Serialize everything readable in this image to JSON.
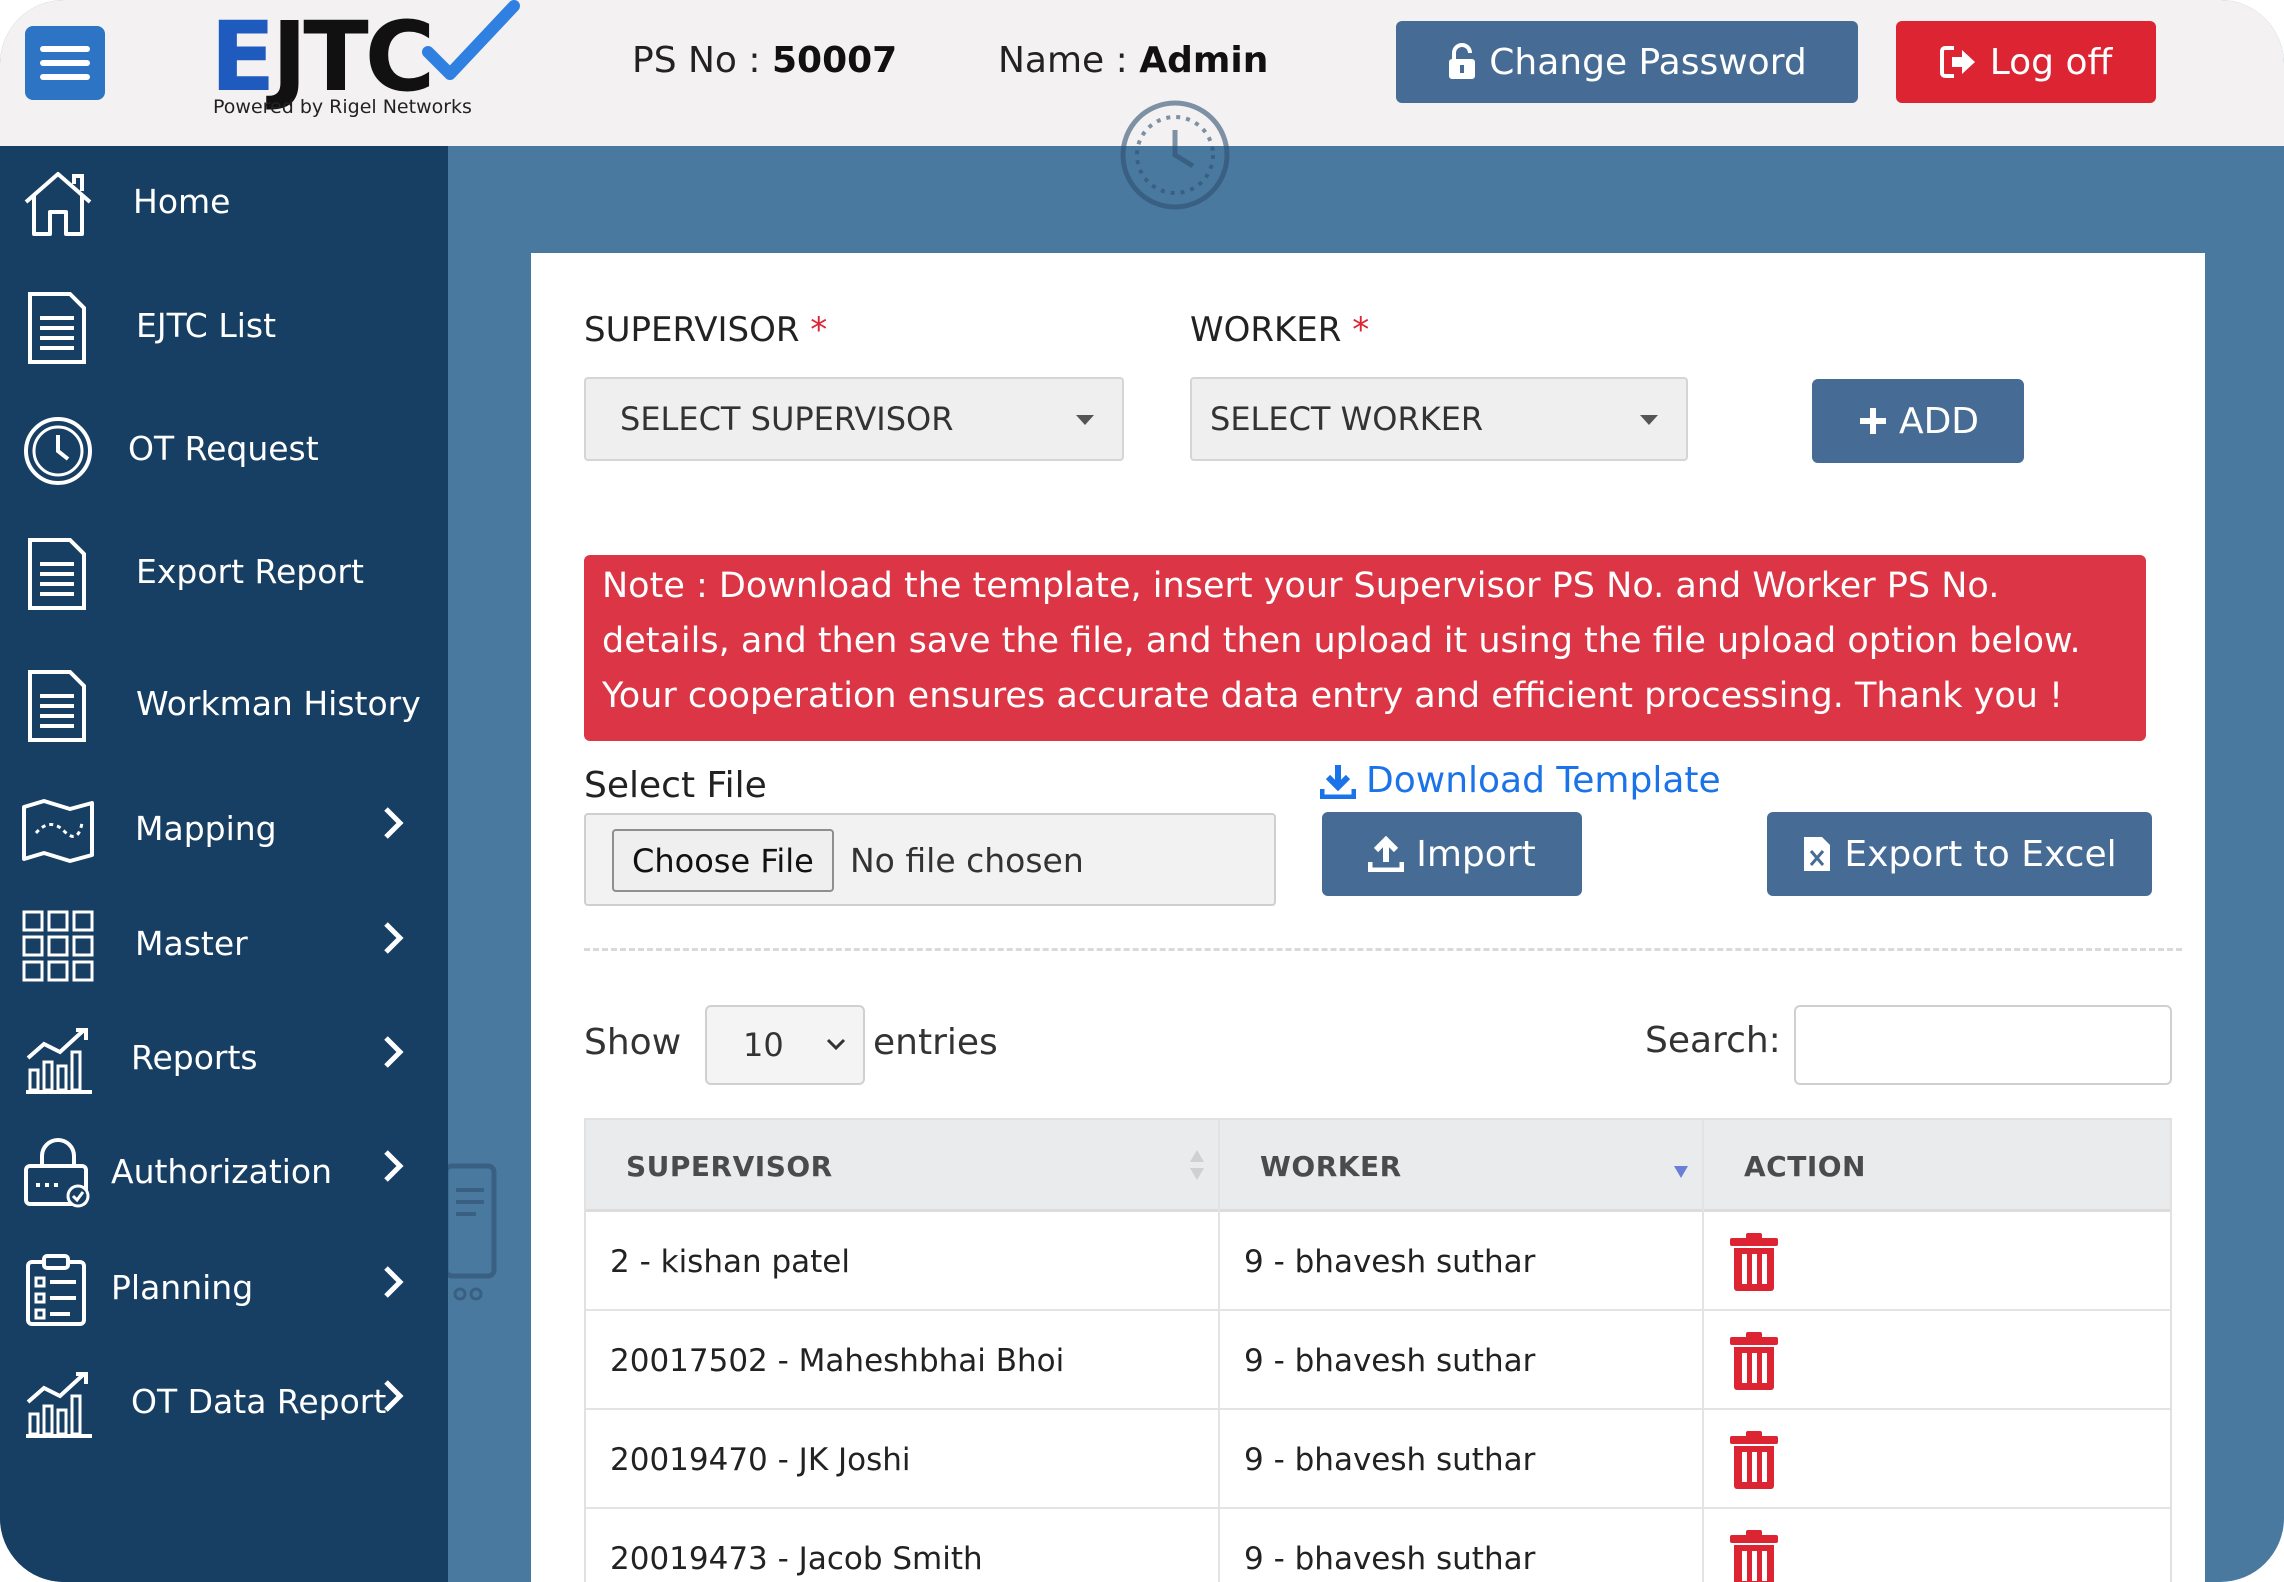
{
  "header": {
    "logo_text_first": "E",
    "logo_text_rest": "JTC",
    "logo_subtitle": "Powered by Rigel Networks",
    "ps_label": "PS No : ",
    "ps_value": "50007",
    "name_label": "Name : ",
    "name_value": "Admin",
    "change_password_label": "Change Password",
    "logoff_label": "Log off"
  },
  "sidebar": {
    "items": [
      {
        "label": "Home",
        "icon": "home-icon",
        "has_submenu": false
      },
      {
        "label": "EJTC List",
        "icon": "document-icon",
        "has_submenu": false
      },
      {
        "label": "OT Request",
        "icon": "clock-icon",
        "has_submenu": false
      },
      {
        "label": "Export Report",
        "icon": "document-icon",
        "has_submenu": false
      },
      {
        "label": "Workman History",
        "icon": "document-icon",
        "has_submenu": false
      },
      {
        "label": "Mapping",
        "icon": "map-icon",
        "has_submenu": true
      },
      {
        "label": "Master",
        "icon": "grid-icon",
        "has_submenu": true
      },
      {
        "label": "Reports",
        "icon": "chart-icon",
        "has_submenu": true
      },
      {
        "label": "Authorization",
        "icon": "lock-icon",
        "has_submenu": true
      },
      {
        "label": "Planning",
        "icon": "clipboard-icon",
        "has_submenu": true
      },
      {
        "label": "OT Data Report",
        "icon": "chart-icon",
        "has_submenu": true
      }
    ]
  },
  "form": {
    "supervisor_label": "SUPERVISOR",
    "supervisor_placeholder": "SELECT SUPERVISOR",
    "worker_label": "WORKER",
    "worker_placeholder": "SELECT WORKER",
    "required_mark": "*",
    "add_label": "ADD"
  },
  "note": {
    "text": "Note : Download the template, insert your Supervisor PS No. and Worker PS No. details, and then save the file, and then upload it using the file upload option below. Your cooperation ensures accurate data entry and efficient processing. Thank you !"
  },
  "upload": {
    "select_file_label": "Select File",
    "choose_file_label": "Choose File",
    "no_file_text": "No file chosen",
    "download_template_label": "Download Template",
    "import_label": "Import",
    "export_excel_label": "Export to Excel"
  },
  "table_controls": {
    "show_label": "Show",
    "entries_value": "10",
    "entries_label": "entries",
    "search_label": "Search:"
  },
  "table": {
    "columns": [
      "SUPERVISOR",
      "WORKER",
      "ACTION"
    ],
    "rows": [
      {
        "supervisor": "2 - kishan patel",
        "worker": "9 - bhavesh suthar"
      },
      {
        "supervisor": "20017502 - Maheshbhai Bhoi",
        "worker": "9 - bhavesh suthar"
      },
      {
        "supervisor": "20019470 - JK Joshi",
        "worker": "9 - bhavesh suthar"
      },
      {
        "supervisor": "20019473 - Jacob Smith",
        "worker": "9 - bhavesh suthar"
      }
    ]
  },
  "colors": {
    "sidebar_bg": "#173e63",
    "main_bg": "#4a79a0",
    "primary_button": "#466b94",
    "danger": "#dc2433",
    "link": "#1a73e8"
  }
}
